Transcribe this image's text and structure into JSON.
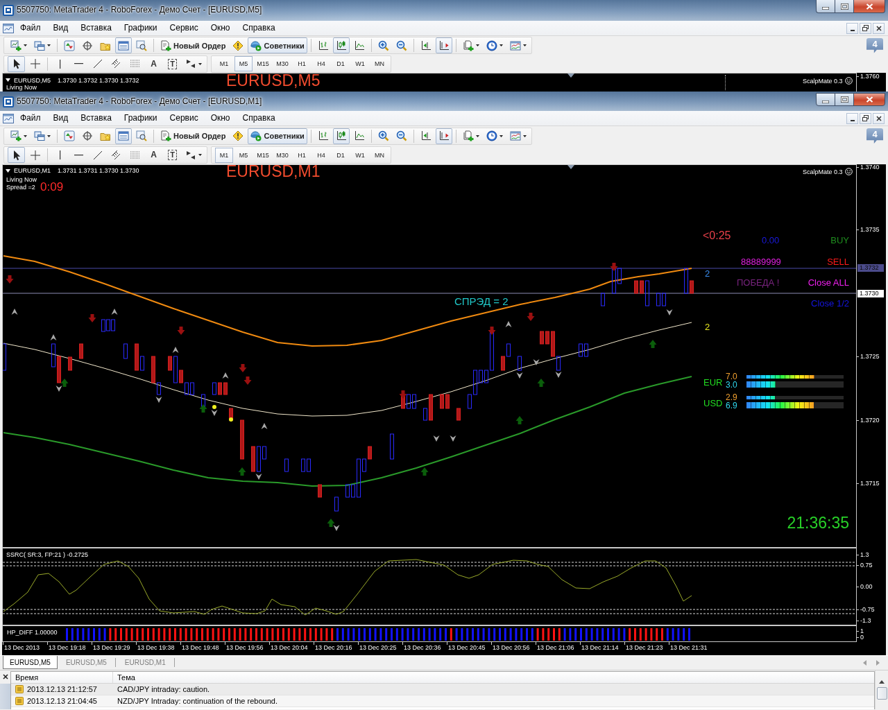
{
  "windows": [
    {
      "title": "5507750: MetaTrader 4 - RoboForex - Демо Счет - [EURUSD,M5]",
      "menu": [
        "Файл",
        "Вид",
        "Вставка",
        "Графики",
        "Сервис",
        "Окно",
        "Справка"
      ],
      "main_toolbar": [
        {
          "kind": "icon",
          "pressed": false
        },
        {
          "kind": "icon",
          "pressed": false
        },
        {
          "kind": "icon",
          "pressed": false
        },
        {
          "kind": "icon",
          "pressed": false
        },
        {
          "kind": "icon",
          "pressed": false
        },
        {
          "kind": "icon",
          "pressed": true
        },
        {
          "kind": "icon",
          "pressed": false
        },
        {
          "kind": "button",
          "label": "Новый Ордер",
          "pressed": false
        },
        {
          "kind": "icon",
          "pressed": false
        },
        {
          "kind": "button",
          "label": "Советники",
          "pressed": true
        },
        {
          "kind": "icon",
          "pressed": false
        },
        {
          "kind": "icon",
          "pressed": true
        },
        {
          "kind": "icon",
          "pressed": false
        },
        {
          "kind": "icon",
          "pressed": false
        },
        {
          "kind": "icon",
          "pressed": false
        },
        {
          "kind": "icon",
          "pressed": false
        },
        {
          "kind": "icon",
          "pressed": true
        },
        {
          "kind": "icon",
          "pressed": false
        },
        {
          "kind": "icon",
          "pressed": false
        },
        {
          "kind": "icon",
          "pressed": false
        }
      ],
      "drawing_toolbar": [
        {
          "kind": "icon",
          "pressed": true
        },
        {
          "kind": "icon",
          "pressed": false
        },
        {
          "kind": "icon",
          "pressed": false
        },
        {
          "kind": "icon",
          "pressed": false
        },
        {
          "kind": "icon",
          "pressed": false
        },
        {
          "kind": "icon",
          "pressed": false
        },
        {
          "kind": "icon",
          "pressed": false
        },
        {
          "kind": "glyph",
          "label": "A",
          "pressed": false
        },
        {
          "kind": "boxed-glyph",
          "label": "T",
          "pressed": false
        },
        {
          "kind": "icon",
          "pressed": false
        }
      ],
      "timeframes": [
        {
          "label": "M1",
          "selected": false
        },
        {
          "label": "M5",
          "selected": true
        },
        {
          "label": "M15",
          "selected": false
        },
        {
          "label": "M30",
          "selected": false
        },
        {
          "label": "H1",
          "selected": false
        },
        {
          "label": "H4",
          "selected": false
        },
        {
          "label": "D1",
          "selected": false
        },
        {
          "label": "W1",
          "selected": false
        },
        {
          "label": "MN",
          "selected": false
        }
      ],
      "messages": "4",
      "chart": {
        "symbol": "EURUSD,M5",
        "ohlc": "1.3730 1.3732 1.3730 1.3732",
        "info": [
          "Living Now"
        ],
        "title": "EURUSD,M5",
        "expert": "ScalpMate 0.3",
        "price_axis": [
          "1.3760"
        ]
      }
    },
    {
      "title": "5507750: MetaTrader 4 - RoboForex - Демо Счет - [EURUSD,M1]",
      "menu": [
        "Файл",
        "Вид",
        "Вставка",
        "Графики",
        "Сервис",
        "Окно",
        "Справка"
      ],
      "main_toolbar": [
        {
          "kind": "icon",
          "pressed": false
        },
        {
          "kind": "icon",
          "pressed": false
        },
        {
          "kind": "icon",
          "pressed": false
        },
        {
          "kind": "icon",
          "pressed": false
        },
        {
          "kind": "icon",
          "pressed": false
        },
        {
          "kind": "icon",
          "pressed": true
        },
        {
          "kind": "icon",
          "pressed": false
        },
        {
          "kind": "button",
          "label": "Новый Ордер",
          "pressed": false
        },
        {
          "kind": "icon",
          "pressed": false
        },
        {
          "kind": "button",
          "label": "Советники",
          "pressed": true
        },
        {
          "kind": "icon",
          "pressed": false
        },
        {
          "kind": "icon",
          "pressed": true
        },
        {
          "kind": "icon",
          "pressed": false
        },
        {
          "kind": "icon",
          "pressed": false
        },
        {
          "kind": "icon",
          "pressed": false
        },
        {
          "kind": "icon",
          "pressed": false
        },
        {
          "kind": "icon",
          "pressed": true
        },
        {
          "kind": "icon",
          "pressed": false
        },
        {
          "kind": "icon",
          "pressed": false
        },
        {
          "kind": "icon",
          "pressed": false
        }
      ],
      "drawing_toolbar": [
        {
          "kind": "icon",
          "pressed": true
        },
        {
          "kind": "icon",
          "pressed": false
        },
        {
          "kind": "icon",
          "pressed": false
        },
        {
          "kind": "icon",
          "pressed": false
        },
        {
          "kind": "icon",
          "pressed": false
        },
        {
          "kind": "icon",
          "pressed": false
        },
        {
          "kind": "icon",
          "pressed": false
        },
        {
          "kind": "glyph",
          "label": "A",
          "pressed": false
        },
        {
          "kind": "boxed-glyph",
          "label": "T",
          "pressed": false
        },
        {
          "kind": "icon",
          "pressed": false
        }
      ],
      "timeframes": [
        {
          "label": "M1",
          "selected": true
        },
        {
          "label": "M5",
          "selected": false
        },
        {
          "label": "M15",
          "selected": false
        },
        {
          "label": "M30",
          "selected": false
        },
        {
          "label": "H1",
          "selected": false
        },
        {
          "label": "H4",
          "selected": false
        },
        {
          "label": "D1",
          "selected": false
        },
        {
          "label": "W1",
          "selected": false
        },
        {
          "label": "MN",
          "selected": false
        }
      ],
      "messages": "4",
      "chart": {
        "symbol": "EURUSD,M1",
        "ohlc": "1.3731 1.3731 1.3730 1.3730",
        "info": [
          "Living Now",
          "Spread =2"
        ],
        "bar_timer": "0:09",
        "title": "EURUSD,M1",
        "expert": "ScalpMate 0.3",
        "panel_labels": [
          {
            "text": "<0:25",
            "color": "#e8404a"
          },
          {
            "text": "0.00",
            "color": "#1a1ae0"
          },
          {
            "text": "BUY",
            "color": "#1f8f1f"
          },
          {
            "text": "88889999",
            "color": "#e020e0"
          },
          {
            "text": "SELL",
            "color": "#ff1a1a"
          },
          {
            "text": "2",
            "color": "#3a8ef0"
          },
          {
            "text": "ПОБЕДА !",
            "color": "#7a2480"
          },
          {
            "text": "Close ALL",
            "color": "#f020f0"
          },
          {
            "text": "СПРЭД = 2",
            "color": "#20c8c8"
          },
          {
            "text": "Close 1/2",
            "color": "#1515e0"
          },
          {
            "text": "2",
            "color": "#e8e820"
          }
        ],
        "currency_strength": [
          {
            "currency": "EUR",
            "readings": [
              {
                "value": "7.0",
                "level": 0.7
              },
              {
                "value": "3.0",
                "level": 0.3
              }
            ]
          },
          {
            "currency": "USD",
            "readings": [
              {
                "value": "2.9",
                "level": 0.29
              },
              {
                "value": "6.9",
                "level": 0.69
              }
            ]
          }
        ],
        "clock": "21:36:35",
        "price_axis": [
          "1.3740",
          "1.3735",
          "1.3725",
          "1.3720",
          "1.3715"
        ],
        "ask_price": "1.3732",
        "bid_price": "1.3730",
        "subwindows": [
          {
            "label": "SSRC( SR:3, FP:21 ) -0.2725",
            "axis": [
              "1.3",
              "0.75",
              "0.00",
              "-0.75",
              "-1.3"
            ]
          },
          {
            "label": "HP_DIFF 1.00000",
            "axis": [
              "1",
              "0"
            ]
          }
        ],
        "time_axis": [
          "13 Dec 2013",
          "13 Dec 19:18",
          "13 Dec 19:29",
          "13 Dec 19:38",
          "13 Dec 19:48",
          "13 Dec 19:56",
          "13 Dec 20:04",
          "13 Dec 20:16",
          "13 Dec 20:25",
          "13 Dec 20:36",
          "13 Dec 20:45",
          "13 Dec 20:56",
          "13 Dec 21:06",
          "13 Dec 21:14",
          "13 Dec 21:23",
          "13 Dec 21:31"
        ]
      }
    }
  ],
  "chart_tabs": [
    {
      "label": "EURUSD,M5",
      "selected": true
    },
    {
      "label": "EURUSD,M5",
      "selected": false
    },
    {
      "label": "EURUSD,M1",
      "selected": false
    }
  ],
  "terminal": {
    "columns": [
      "Время",
      "Тема"
    ],
    "rows": [
      [
        "2013.12.13 21:12:57",
        "CAD/JPY intraday: caution."
      ],
      [
        "2013.12.13 21:04:45",
        "NZD/JPY Intraday: continuation of the rebound."
      ]
    ]
  }
}
